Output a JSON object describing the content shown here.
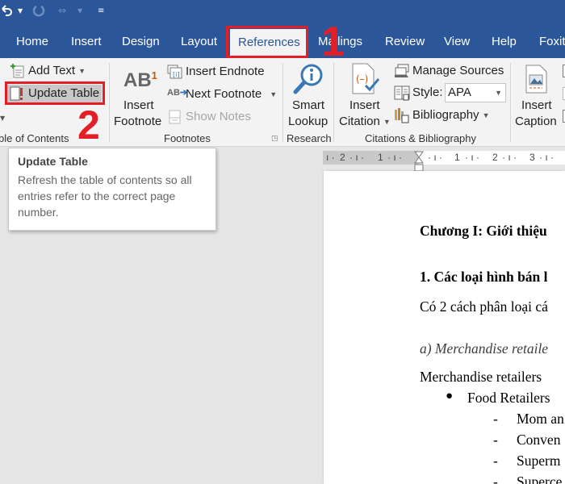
{
  "quick_access": {
    "undo_icon": "undo-icon",
    "redo_icon": "redo-icon",
    "customize_icon": "customize-quick-access-icon"
  },
  "tabs": [
    {
      "label": "Home"
    },
    {
      "label": "Insert"
    },
    {
      "label": "Design"
    },
    {
      "label": "Layout"
    },
    {
      "label": "References",
      "active": true
    },
    {
      "label": "Mailings"
    },
    {
      "label": "Review"
    },
    {
      "label": "View"
    },
    {
      "label": "Help"
    },
    {
      "label": "Foxit"
    }
  ],
  "annotations": {
    "step1": "1",
    "step2": "2",
    "color": "#e21f26"
  },
  "ribbon": {
    "toc_group": {
      "add_text": "Add Text",
      "update_table": "Update Table",
      "label": "ble of Contents"
    },
    "footnotes_group": {
      "insert_footnote_line1": "Insert",
      "insert_footnote_line2": "Footnote",
      "ab_glyph": "AB",
      "superscript": "1",
      "insert_endnote": "Insert Endnote",
      "next_footnote": "Next Footnote",
      "show_notes": "Show Notes",
      "label": "Footnotes"
    },
    "research_group": {
      "smart_lookup_line1": "Smart",
      "smart_lookup_line2": "Lookup",
      "label": "Research"
    },
    "citations_group": {
      "insert_citation_line1": "Insert",
      "insert_citation_line2": "Citation",
      "manage_sources": "Manage Sources",
      "style_label": "Style:",
      "style_value": "APA",
      "bibliography": "Bibliography",
      "label": "Citations & Bibliography"
    },
    "captions_group": {
      "insert_caption_line1": "Insert",
      "insert_caption_line2": "Caption"
    }
  },
  "tooltip": {
    "title": "Update Table",
    "body": "Refresh the table of contents so all entries refer to the correct page number."
  },
  "ruler": {
    "ticks": [
      "2",
      "1",
      "1",
      "2",
      "3"
    ]
  },
  "document": {
    "heading": "Chương I: Giới thiệu",
    "section": "1. Các loại hình bán l",
    "paragraph": "Có 2 cách phân loại cá",
    "subheading": "a) Merchandise retaile",
    "body_line": "Merchandise retailers",
    "bullet": "Food Retailers",
    "sub_items": [
      "Mom an",
      "Conven",
      "Superm",
      "Superce"
    ]
  }
}
